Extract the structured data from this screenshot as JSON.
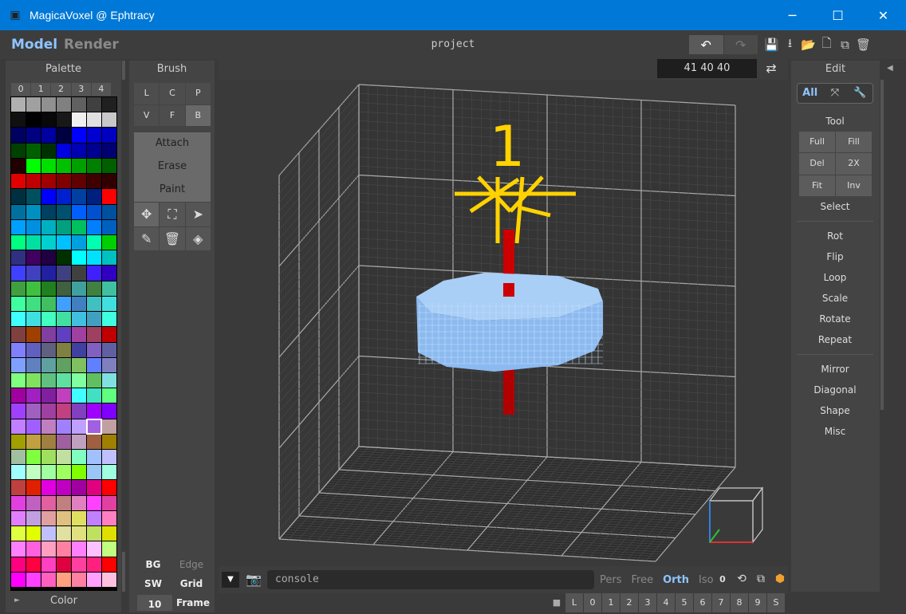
{
  "window": {
    "title": "MagicaVoxel @ Ephtracy",
    "minimize": "─",
    "maximize": "☐",
    "close": "✕"
  },
  "top": {
    "mode_model": "Model",
    "mode_render": "Render",
    "project": "project",
    "undo": "↶",
    "redo": "↷"
  },
  "palette": {
    "title": "Palette",
    "tabs": [
      "0",
      "1",
      "2",
      "3",
      "4"
    ],
    "footer": "Color",
    "selected_index": 152,
    "colors": [
      "#b0b0b0",
      "#a0a0a0",
      "#909090",
      "#808080",
      "#606060",
      "#404040",
      "#202020",
      "#101010",
      "#000000",
      "#080808",
      "#181818",
      "#f0f0f0",
      "#e0e0e0",
      "#c8c8c8",
      "#000060",
      "#000080",
      "#0000a0",
      "#000040",
      "#0000ff",
      "#0000d0",
      "#0000c0",
      "#004000",
      "#006000",
      "#003000",
      "#0000e0",
      "#0000b0",
      "#000090",
      "#000070",
      "#200000",
      "#00ff00",
      "#00e000",
      "#00c000",
      "#00a000",
      "#008000",
      "#006000",
      "#e00000",
      "#c00000",
      "#a00000",
      "#800000",
      "#600000",
      "#400000",
      "#300000",
      "#003040",
      "#005060",
      "#0000ff",
      "#0020d0",
      "#0040a0",
      "#002080",
      "#ff0000",
      "#0070a0",
      "#0090c0",
      "#004060",
      "#005070",
      "#0060ff",
      "#0050d0",
      "#0050a0",
      "#00a0ff",
      "#0090e0",
      "#00b0c0",
      "#00a080",
      "#00c060",
      "#0080ff",
      "#0060c0",
      "#00ff80",
      "#00e0a0",
      "#00d0d0",
      "#00c0ff",
      "#00a0e0",
      "#00ffb0",
      "#00d000",
      "#303080",
      "#400060",
      "#200040",
      "#003000",
      "#00ffff",
      "#00e0ff",
      "#00c0c0",
      "#4040ff",
      "#4040c0",
      "#2020a0",
      "#404080",
      "#404040",
      "#4020ff",
      "#3000c0",
      "#40a040",
      "#40c040",
      "#208020",
      "#406040",
      "#40a0a0",
      "#408040",
      "#40c0a0",
      "#40ffa0",
      "#40e080",
      "#40c060",
      "#40a0ff",
      "#4080c0",
      "#40c0c0",
      "#40e0e0",
      "#40ffff",
      "#40e0e0",
      "#40ffc0",
      "#40e0a0",
      "#40c0e0",
      "#40a0c0",
      "#40ffe0",
      "#804040",
      "#a04000",
      "#8040a0",
      "#6040c0",
      "#a040a0",
      "#a04060",
      "#c00000",
      "#8080ff",
      "#6060c0",
      "#606080",
      "#808040",
      "#4040a0",
      "#8060c0",
      "#6060a0",
      "#80a0ff",
      "#6080c0",
      "#60a0a0",
      "#60a060",
      "#80c060",
      "#6080ff",
      "#8080c0",
      "#80ff80",
      "#80e060",
      "#60c080",
      "#60e0a0",
      "#80ffa0",
      "#60c060",
      "#80e0e0",
      "#a000a0",
      "#a020c0",
      "#8020a0",
      "#c040c0",
      "#40ffff",
      "#40e0c0",
      "#60ff80",
      "#a040ff",
      "#a060c0",
      "#a040a0",
      "#c04080",
      "#8040c0",
      "#a000ff",
      "#8000ff",
      "#c080ff",
      "#a060ff",
      "#c080c0",
      "#a080ff",
      "#c0a0ff",
      "#a060e0",
      "#c0a0a0",
      "#a0a000",
      "#c0a040",
      "#a08040",
      "#a060a0",
      "#c0a0c0",
      "#a06040",
      "#a08000",
      "#a0c0a0",
      "#80ff40",
      "#a0e060",
      "#c0e0a0",
      "#80ffc0",
      "#a0c0ff",
      "#c0c0ff",
      "#a0ffff",
      "#c0ffc0",
      "#a0ffa0",
      "#a0ff60",
      "#80ff00",
      "#9ac6f5",
      "#a0ffe0",
      "#c04040",
      "#e02000",
      "#e000e0",
      "#c000c0",
      "#a000a0",
      "#e00080",
      "#ff0000",
      "#e040e0",
      "#c060c0",
      "#e060a0",
      "#c08080",
      "#e080c0",
      "#ff40ff",
      "#e040a0",
      "#e080ff",
      "#c0a0e0",
      "#e0a0a0",
      "#e0c080",
      "#e0e060",
      "#c080ff",
      "#ff80c0",
      "#e0ff40",
      "#e0ff00",
      "#c0c0ff",
      "#e0e0a0",
      "#e0e080",
      "#c0e060",
      "#e0e000",
      "#ff80ff",
      "#ff60e0",
      "#ffa0c0",
      "#ff80a0",
      "#ff80ff",
      "#ffc0ff",
      "#c0ff80",
      "#ff0080",
      "#ff0040",
      "#ff40c0",
      "#e00040",
      "#ff40a0",
      "#ff2080",
      "#ff0000",
      "#ff00ff",
      "#ff40ff",
      "#ff60c0",
      "#ffa080",
      "#ff80a0",
      "#ffa0ff",
      "#ffc0e0",
      "#ffa040",
      "#ff8000",
      "#ff60a0",
      "#ff8080",
      "#ffa060",
      "#ff8060",
      "#ff6040",
      "#ffc080",
      "#ffc060",
      "#ffe060",
      "#ffe0a0",
      "#ffc0c0",
      "#ffe0ff",
      "#ffa0a0",
      "#ffe080",
      "#ffd000",
      "#ffff00",
      "#ffff80",
      "#ffe040",
      "#ffc020",
      "#ffd080",
      "#ffffff",
      "#ffffe0",
      "#fffff0",
      "#ffffc0",
      "#fff0f0",
      "#ffe0e0",
      "#ffc0ff"
    ]
  },
  "brush": {
    "title": "Brush",
    "modes": [
      "L",
      "C",
      "P",
      "V",
      "F",
      "B"
    ],
    "active_mode": "B",
    "actions": [
      "Attach",
      "Erase",
      "Paint"
    ],
    "tool_icons": [
      "move-icon",
      "select-box-icon",
      "cursor-icon",
      "eyedropper-icon",
      "trash-icon",
      "bucket-icon"
    ],
    "bottom": {
      "bg": "BG",
      "edge": "Edge",
      "sw": "SW",
      "grid": "Grid",
      "grid_size": "10",
      "frame": "Frame"
    }
  },
  "viewport": {
    "coords": "41  40  40",
    "overlay_label": "1",
    "voxel_color": "#9ac6f5",
    "axis_color": "#cc0000"
  },
  "console": {
    "placeholder": "console",
    "views": [
      "Pers",
      "Free",
      "Orth",
      "Iso"
    ],
    "active_view": "Orth",
    "zero": "0",
    "layers": [
      "L",
      "0",
      "1",
      "2",
      "3",
      "4",
      "5",
      "6",
      "7",
      "8",
      "9",
      "S"
    ]
  },
  "edit": {
    "title": "Edit",
    "tabs": [
      "All",
      "⤧",
      "🔧"
    ],
    "active_tab": "All",
    "tool_title": "Tool",
    "tool_btns": [
      "Full",
      "Fill",
      "Del",
      "2X",
      "Fit",
      "Inv"
    ],
    "select": "Select",
    "group1": [
      "Rot",
      "Flip",
      "Loop",
      "Scale",
      "Rotate",
      "Repeat"
    ],
    "group2": [
      "Mirror",
      "Diagonal",
      "Shape",
      "Misc"
    ]
  }
}
